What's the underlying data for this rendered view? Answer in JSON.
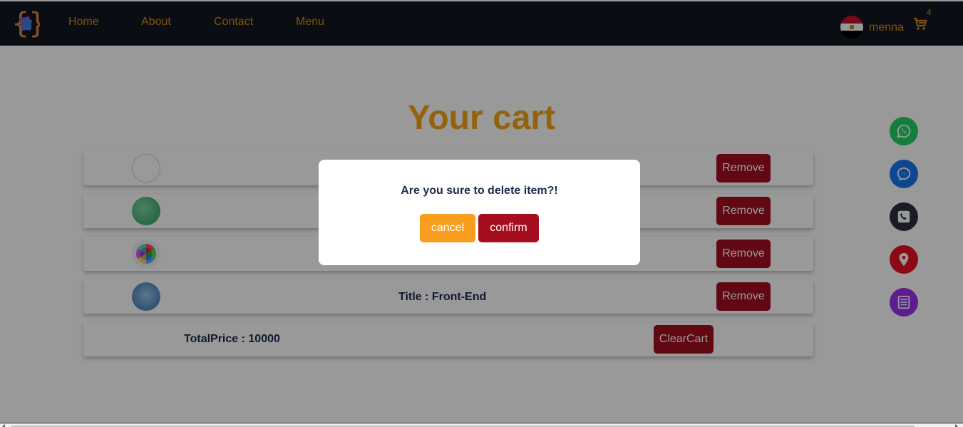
{
  "nav": {
    "links": [
      "Home",
      "About",
      "Contact",
      "Menu"
    ],
    "username": "menna",
    "cart_count": "4",
    "text_color": "#d58a0f",
    "background": "#121722"
  },
  "main": {
    "title": "Your cart",
    "items": [
      {
        "thumb": "empty-image-icon",
        "title": "",
        "remove_label": "Remove"
      },
      {
        "thumb": "server-image-icon",
        "title": "",
        "remove_label": "Remove"
      },
      {
        "thumb": "apps-image-icon",
        "title": "",
        "remove_label": "Remove"
      },
      {
        "thumb": "front-end-image-icon",
        "title": "Title : Front-End",
        "remove_label": "Remove"
      }
    ],
    "total": "TotalPrice : 10000",
    "clear_label": "ClearCart"
  },
  "social": [
    {
      "name": "whatsapp-icon",
      "color": "#25d366"
    },
    {
      "name": "messenger-icon",
      "color": "#1877f2"
    },
    {
      "name": "phone-icon",
      "color": "#2a2f3d"
    },
    {
      "name": "location-icon",
      "color": "#e81123"
    },
    {
      "name": "menu-list-icon",
      "color": "#9b2ff0"
    }
  ],
  "modal": {
    "message": "Are you sure to delete item?!",
    "cancel_label": "cancel",
    "confirm_label": "confirm"
  },
  "colors": {
    "accent": "#f5a315",
    "danger": "#a40e1f",
    "cancel": "#f99d1c"
  }
}
